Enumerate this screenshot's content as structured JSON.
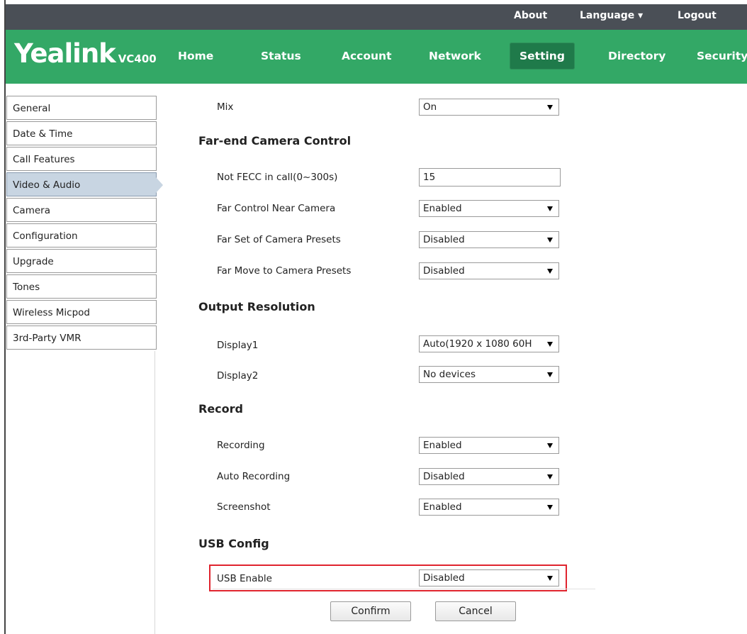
{
  "topbar": {
    "about": "About",
    "language": "Language ▾",
    "logout": "Logout"
  },
  "brand": {
    "name": "Yealink",
    "model": "VC400"
  },
  "nav": {
    "home": "Home",
    "status": "Status",
    "account": "Account",
    "network": "Network",
    "setting": "Setting",
    "directory": "Directory",
    "security": "Security"
  },
  "sidebar": {
    "items": [
      {
        "label": "General"
      },
      {
        "label": "Date & Time"
      },
      {
        "label": "Call Features"
      },
      {
        "label": "Video & Audio",
        "active": true
      },
      {
        "label": "Camera"
      },
      {
        "label": "Configuration"
      },
      {
        "label": "Upgrade"
      },
      {
        "label": "Tones"
      },
      {
        "label": "Wireless Micpod"
      },
      {
        "label": "3rd-Party VMR"
      }
    ]
  },
  "form": {
    "mix": {
      "label": "Mix",
      "value": "On"
    },
    "fecc_section": "Far-end Camera Control",
    "not_fecc": {
      "label": "Not FECC in call(0~300s)",
      "value": "15"
    },
    "far_control": {
      "label": "Far Control Near Camera",
      "value": "Enabled"
    },
    "far_set": {
      "label": "Far Set of Camera Presets",
      "value": "Disabled"
    },
    "far_move": {
      "label": "Far Move to Camera Presets",
      "value": "Disabled"
    },
    "output_section": "Output Resolution",
    "display1": {
      "label": "Display1",
      "value": "Auto(1920 x 1080 60H"
    },
    "display2": {
      "label": "Display2",
      "value": "No devices"
    },
    "record_section": "Record",
    "recording": {
      "label": "Recording",
      "value": "Enabled"
    },
    "auto_recording": {
      "label": "Auto Recording",
      "value": "Disabled"
    },
    "screenshot": {
      "label": "Screenshot",
      "value": "Enabled"
    },
    "usb_section": "USB Config",
    "usb_enable": {
      "label": "USB Enable",
      "value": "Disabled"
    }
  },
  "buttons": {
    "confirm": "Confirm",
    "cancel": "Cancel"
  },
  "colors": {
    "topbar": "#4a4f56",
    "navbar": "#33a866",
    "active_tab": "#1f7a4a",
    "highlight": "#e0242e"
  }
}
